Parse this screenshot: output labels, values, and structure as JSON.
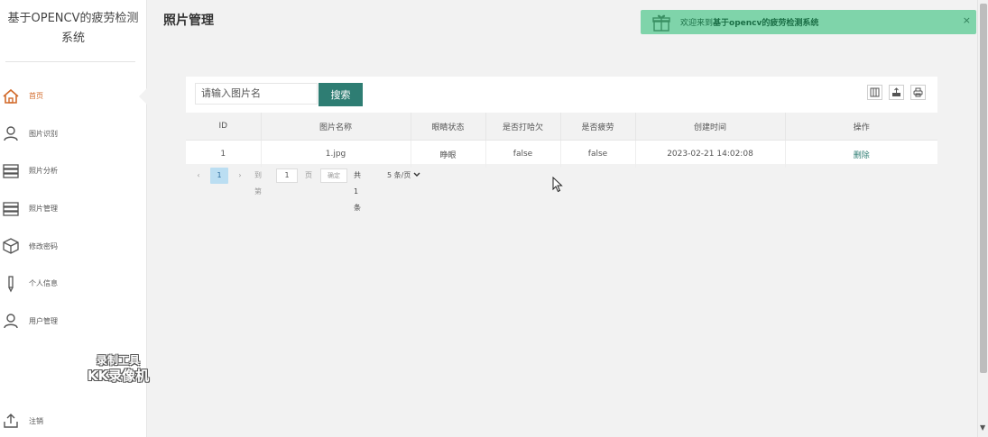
{
  "app": {
    "title_line1": "基于OPENCV的疲劳检测",
    "title_line2": "系统"
  },
  "sidebar": {
    "items": [
      {
        "label": "首页",
        "icon": "home-icon",
        "active": true
      },
      {
        "label": "图片识别",
        "icon": "user-icon"
      },
      {
        "label": "照片分析",
        "icon": "list-icon"
      },
      {
        "label": "照片管理",
        "icon": "list-icon"
      },
      {
        "label": "修改密码",
        "icon": "box-icon"
      },
      {
        "label": "个人信息",
        "icon": "pen-icon"
      },
      {
        "label": "用户管理",
        "icon": "user-icon"
      }
    ],
    "logout_label": "注销"
  },
  "watermark": {
    "line1": "录制工具",
    "line2": "KK录像机"
  },
  "header": {
    "title": "照片管理"
  },
  "toast": {
    "message_prefix": "欢迎来到",
    "message_bold": "基于opencv的疲劳检测系统",
    "close": "×",
    "color": "#7fd4aa"
  },
  "search": {
    "placeholder": "请输入图片名",
    "button": "搜索",
    "button_color": "#2e7d73"
  },
  "toolbar": {
    "icons": [
      "columns-icon",
      "export-icon",
      "print-icon"
    ]
  },
  "table": {
    "columns": [
      "ID",
      "图片名称",
      "眼睛状态",
      "是否打哈欠",
      "是否疲劳",
      "创建时间",
      "操作"
    ],
    "rows": [
      {
        "id": "1",
        "name": "1.jpg",
        "eye_state": "睁眼",
        "yawn": "false",
        "fatigue": "false",
        "created": "2023-02-21 14:02:08",
        "action": "删除"
      }
    ]
  },
  "pager": {
    "prev": "‹",
    "current": "1",
    "next": "›",
    "goto_label": "到第",
    "goto_value": "1",
    "page_label": "页",
    "confirm": "确定",
    "total": "共 1 条",
    "page_size": "5 条/页"
  }
}
